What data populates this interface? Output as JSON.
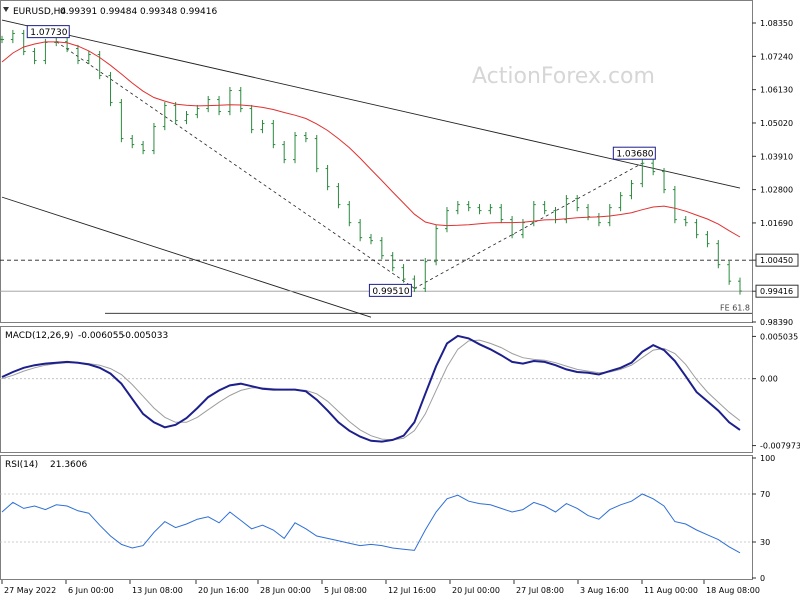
{
  "watermark": "ActionForex.com",
  "colors": {
    "price": "#2b8a3e",
    "ma": "#e03131",
    "channel": "#222222",
    "macd": "#1c1f8c",
    "signal": "#9e9e9e",
    "rsi": "#2f6fd6",
    "grid": "#bdbdbd",
    "border": "#7f7f7f"
  },
  "chart_data": [
    {
      "type": "ohlc",
      "title": "EURUSD,H4",
      "ohlc_header": [
        "0.99391",
        "0.99484",
        "0.99348",
        "0.99416"
      ],
      "ylim": [
        0.9839,
        1.0885
      ],
      "y_ticks": [
        "1.08350",
        "1.07240",
        "1.06130",
        "1.05020",
        "1.03910",
        "1.02800",
        "1.01690",
        "1.00450",
        "0.99416",
        "0.98390"
      ],
      "x_ticks": [
        "27 May 2022",
        "6 Jun 00:00",
        "13 Jun 08:00",
        "20 Jun 16:00",
        "28 Jun 00:00",
        "5 Jul 08:00",
        "12 Jul 16:00",
        "20 Jul 00:00",
        "27 Jul 08:00",
        "3 Aug 16:00",
        "11 Aug 00:00",
        "18 Aug 08:00"
      ],
      "price_series": [
        1.078,
        1.08,
        1.074,
        1.071,
        1.077,
        1.0773,
        1.075,
        1.071,
        1.073,
        1.066,
        1.057,
        1.045,
        1.043,
        1.041,
        1.049,
        1.056,
        1.051,
        1.053,
        1.055,
        1.058,
        1.054,
        1.061,
        1.055,
        1.048,
        1.05,
        1.043,
        1.038,
        1.046,
        1.045,
        1.035,
        1.029,
        1.023,
        1.017,
        1.012,
        1.011,
        1.006,
        1.002,
        0.9982,
        0.9951,
        1.004,
        1.015,
        1.021,
        1.023,
        1.022,
        1.021,
        1.022,
        1.018,
        1.013,
        1.017,
        1.023,
        1.021,
        1.018,
        1.025,
        1.022,
        1.019,
        1.017,
        1.022,
        1.026,
        1.03,
        1.0368,
        1.034,
        1.028,
        1.018,
        1.017,
        1.013,
        1.01,
        1.003,
        0.9975,
        0.9942
      ],
      "ma_series": [
        1.0705,
        1.0735,
        1.0755,
        1.0765,
        1.0772,
        1.0772,
        1.0769,
        1.0758,
        1.0742,
        1.072,
        1.0694,
        1.0665,
        1.0635,
        1.0608,
        1.0587,
        1.0575,
        1.0565,
        1.0561,
        1.0559,
        1.056,
        1.0561,
        1.0563,
        1.0562,
        1.0559,
        1.0554,
        1.0547,
        1.0537,
        1.0528,
        1.0517,
        1.0499,
        1.0477,
        1.045,
        1.042,
        1.0385,
        1.0347,
        1.031,
        1.0272,
        1.0235,
        1.0198,
        1.0172,
        1.0163,
        1.016,
        1.0161,
        1.0163,
        1.0166,
        1.0169,
        1.017,
        1.017,
        1.0171,
        1.0175,
        1.0179,
        1.018,
        1.0183,
        1.0186,
        1.0188,
        1.0189,
        1.0192,
        1.0197,
        1.0203,
        1.0213,
        1.0222,
        1.0225,
        1.0218,
        1.0208,
        1.0195,
        1.0182,
        1.0165,
        1.0143,
        1.0122
      ],
      "annotations": [
        {
          "text": "1.07730",
          "x_index": 5,
          "y": 1.0773
        },
        {
          "text": "0.99510",
          "x_index": 38,
          "y": 0.9951
        },
        {
          "text": "1.03680",
          "x_index": 59,
          "y": 1.0368
        }
      ],
      "levels": [
        {
          "value": 1.0045,
          "style": "dashed",
          "label": "1.00450"
        },
        {
          "value": 0.99416,
          "style": "solid",
          "label": "0.99416"
        },
        {
          "value": 0.9868,
          "style": "solid",
          "label": "FE 61.8"
        }
      ],
      "channel_upper": {
        "x": [
          0,
          68
        ],
        "y": [
          1.0845,
          1.0285
        ]
      },
      "channel_lower": {
        "x": [
          0,
          34
        ],
        "y": [
          1.0255,
          0.9855
        ]
      },
      "projection_lines": [
        {
          "x": [
            5,
            38
          ],
          "y": [
            1.0773,
            0.9951
          ]
        },
        {
          "x": [
            38,
            59
          ],
          "y": [
            0.9951,
            1.0368
          ]
        }
      ]
    },
    {
      "type": "line",
      "title": "MACD(12,26,9)",
      "header_values": [
        "-0.006055",
        "-0.005033"
      ],
      "ylim": [
        -0.0085,
        0.0058
      ],
      "y_ticks": [
        "0.005035",
        "0.00",
        "-0.007973"
      ],
      "zero_line": 0,
      "series": [
        {
          "values": [
            0.0002,
            0.0008,
            0.0013,
            0.0016,
            0.0018,
            0.0019,
            0.002,
            0.0019,
            0.0017,
            0.0013,
            0.0006,
            -0.0006,
            -0.0024,
            -0.0042,
            -0.0052,
            -0.0058,
            -0.0055,
            -0.0047,
            -0.0035,
            -0.0022,
            -0.0014,
            -0.0008,
            -0.0006,
            -0.0009,
            -0.0012,
            -0.0013,
            -0.0013,
            -0.0013,
            -0.0015,
            -0.0025,
            -0.0038,
            -0.0052,
            -0.0062,
            -0.0069,
            -0.0074,
            -0.0075,
            -0.0073,
            -0.0068,
            -0.0052,
            -0.0018,
            0.0015,
            0.0042,
            0.0051,
            0.0048,
            0.0041,
            0.0035,
            0.0028,
            0.002,
            0.0018,
            0.0021,
            0.002,
            0.0016,
            0.0011,
            0.0008,
            0.0007,
            0.0005,
            0.0009,
            0.0013,
            0.0019,
            0.0032,
            0.004,
            0.0034,
            0.0021,
            0.0003,
            -0.0016,
            -0.0027,
            -0.0038,
            -0.0052,
            -0.0061
          ]
        },
        {
          "values": [
            0.0,
            0.0004,
            0.0009,
            0.0013,
            0.0016,
            0.0018,
            0.0019,
            0.0019,
            0.0018,
            0.0016,
            0.0012,
            0.0005,
            -0.0007,
            -0.0021,
            -0.0035,
            -0.0046,
            -0.0052,
            -0.0052,
            -0.0046,
            -0.0037,
            -0.0028,
            -0.002,
            -0.0014,
            -0.0011,
            -0.0011,
            -0.0012,
            -0.0013,
            -0.0013,
            -0.0014,
            -0.0018,
            -0.0027,
            -0.0039,
            -0.0051,
            -0.0061,
            -0.0068,
            -0.0072,
            -0.0073,
            -0.0071,
            -0.0062,
            -0.0042,
            -0.0014,
            0.0014,
            0.0035,
            0.0045,
            0.0046,
            0.0042,
            0.0037,
            0.003,
            0.0025,
            0.0023,
            0.0022,
            0.0019,
            0.0015,
            0.0011,
            0.0009,
            0.0007,
            0.0008,
            0.0011,
            0.0016,
            0.0025,
            0.0034,
            0.0036,
            0.003,
            0.0017,
            -0.0001,
            -0.0016,
            -0.0028,
            -0.004,
            -0.005
          ]
        }
      ]
    },
    {
      "type": "line",
      "title": "RSI(14)",
      "header_values": [
        "21.3606"
      ],
      "ylim": [
        0,
        100
      ],
      "y_ticks": [
        "100",
        "70",
        "30",
        "0"
      ],
      "levels": [
        70,
        30
      ],
      "series": [
        {
          "values": [
            55,
            63,
            58,
            60,
            57,
            61,
            60,
            56,
            54,
            44,
            35,
            28,
            25,
            27,
            38,
            47,
            42,
            45,
            49,
            51,
            46,
            55,
            48,
            41,
            44,
            40,
            33,
            46,
            41,
            35,
            33,
            31,
            29,
            27,
            28,
            27,
            25,
            24,
            23,
            40,
            55,
            66,
            69,
            64,
            62,
            61,
            58,
            55,
            57,
            63,
            60,
            55,
            62,
            58,
            52,
            49,
            57,
            61,
            64,
            70,
            66,
            60,
            47,
            45,
            40,
            36,
            32,
            26,
            21
          ]
        }
      ]
    }
  ]
}
